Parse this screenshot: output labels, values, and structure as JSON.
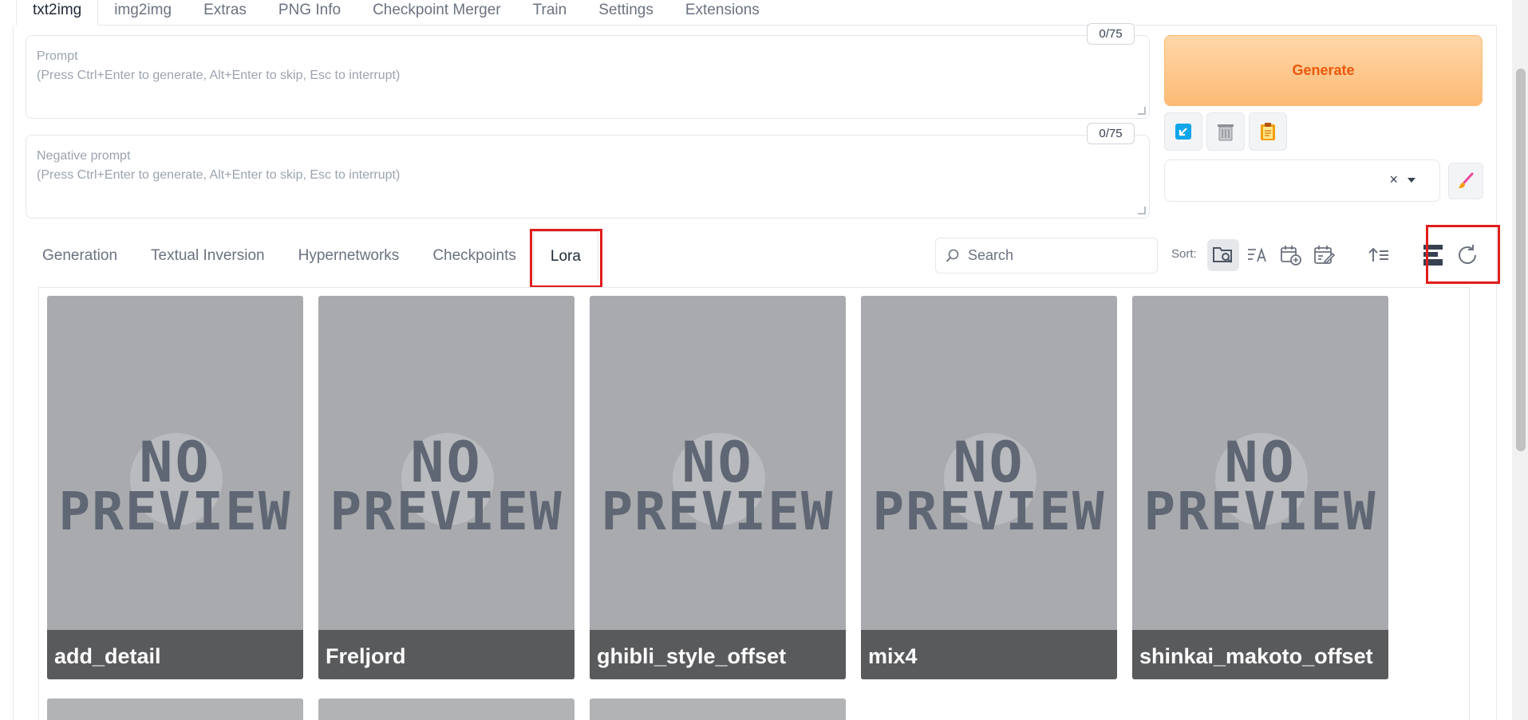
{
  "top_tabs": [
    "txt2img",
    "img2img",
    "Extras",
    "PNG Info",
    "Checkpoint Merger",
    "Train",
    "Settings",
    "Extensions"
  ],
  "prompt": {
    "placeholder": "Prompt\n(Press Ctrl+Enter to generate, Alt+Enter to skip, Esc to interrupt)",
    "counter": "0/75"
  },
  "negative_prompt": {
    "placeholder": "Negative prompt\n(Press Ctrl+Enter to generate, Alt+Enter to skip, Esc to interrupt)",
    "counter": "0/75"
  },
  "generate_label": "Generate",
  "style_select": {
    "clear_glyph": "×"
  },
  "sub_tabs": [
    "Generation",
    "Textual Inversion",
    "Hypernetworks",
    "Checkpoints",
    "Lora"
  ],
  "active_sub_tab": "Lora",
  "search": {
    "placeholder": "Search"
  },
  "sort_label": "Sort:",
  "no_preview": {
    "line1": "NO",
    "line2": "PREVIEW"
  },
  "lora_cards": [
    {
      "name": "add_detail"
    },
    {
      "name": "Freljord"
    },
    {
      "name": "ghibli_style_offset"
    },
    {
      "name": "mix4"
    },
    {
      "name": "shinkai_makoto_offset"
    }
  ],
  "highlight_color": "#e11d1d",
  "accent_color": "#ea580c"
}
